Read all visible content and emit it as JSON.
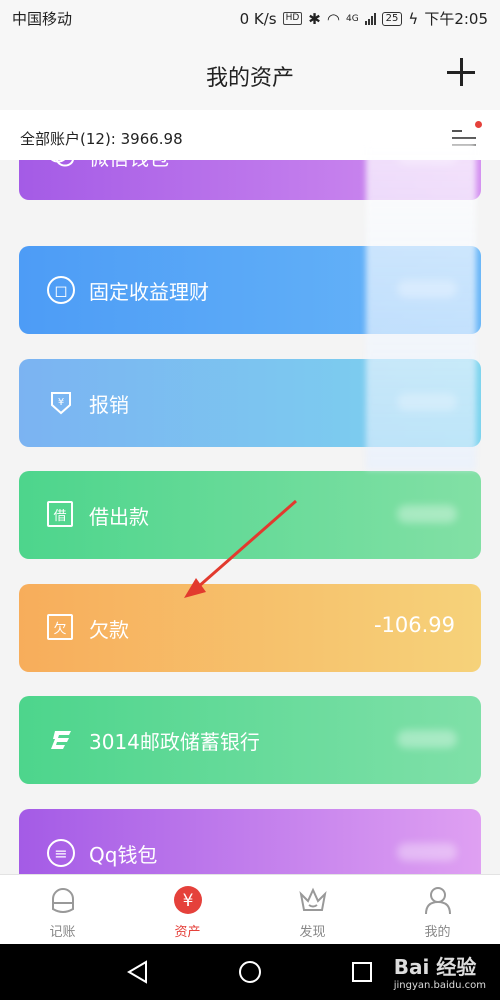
{
  "status_bar": {
    "carrier": "中国移动",
    "speed": "0 K/s",
    "hd": "HD",
    "network": "4G",
    "battery": "25",
    "time": "下午2:05"
  },
  "header": {
    "title": "我的资产",
    "add_icon": "plus-icon"
  },
  "summary": {
    "total": "全部账户(12): 3966.98",
    "list_icon": "list-icon",
    "badge_color": "#e5413b"
  },
  "accounts": [
    {
      "name": "微信钱包",
      "value": "",
      "icon": "wechat-icon",
      "colors": [
        "#a45be6",
        "#d38ff0"
      ]
    },
    {
      "name": "固定收益理财",
      "value": "",
      "icon": "fixed-income-icon",
      "colors": [
        "#4d9cf6",
        "#68b6f8"
      ]
    },
    {
      "name": "报销",
      "value": "",
      "icon": "reimburse-icon",
      "colors": [
        "#7bb3f2",
        "#7cd4ee"
      ]
    },
    {
      "name": "借出款",
      "value": "",
      "icon": "loan-out-icon",
      "colors": [
        "#4dd58c",
        "#82e0a5"
      ]
    },
    {
      "name": "欠款",
      "value": "-106.99",
      "icon": "debt-icon",
      "colors": [
        "#f7ad5b",
        "#f6d27a"
      ]
    },
    {
      "name": "3014邮政储蓄银行",
      "value": "",
      "icon": "postal-bank-icon",
      "colors": [
        "#4dd58c",
        "#7fe0a8"
      ]
    },
    {
      "name": "Qq钱包",
      "value": "",
      "icon": "qq-wallet-icon",
      "colors": [
        "#a45be6",
        "#dfa0f2"
      ]
    }
  ],
  "tabbar": {
    "items": [
      {
        "label": "记账",
        "icon": "bookkeeping-icon",
        "active": false
      },
      {
        "label": "资产",
        "icon": "yuan-icon",
        "active": true
      },
      {
        "label": "发现",
        "icon": "crown-icon",
        "active": false
      },
      {
        "label": "我的",
        "icon": "user-icon",
        "active": false
      }
    ],
    "active_color": "#e5413b"
  },
  "navbar": {
    "back_icon": "back-triangle-icon",
    "home_icon": "home-circle-icon",
    "recent_icon": "recent-square-icon"
  },
  "watermark": {
    "text": "Bai 经验",
    "sub": "jingyan.baidu.com"
  }
}
